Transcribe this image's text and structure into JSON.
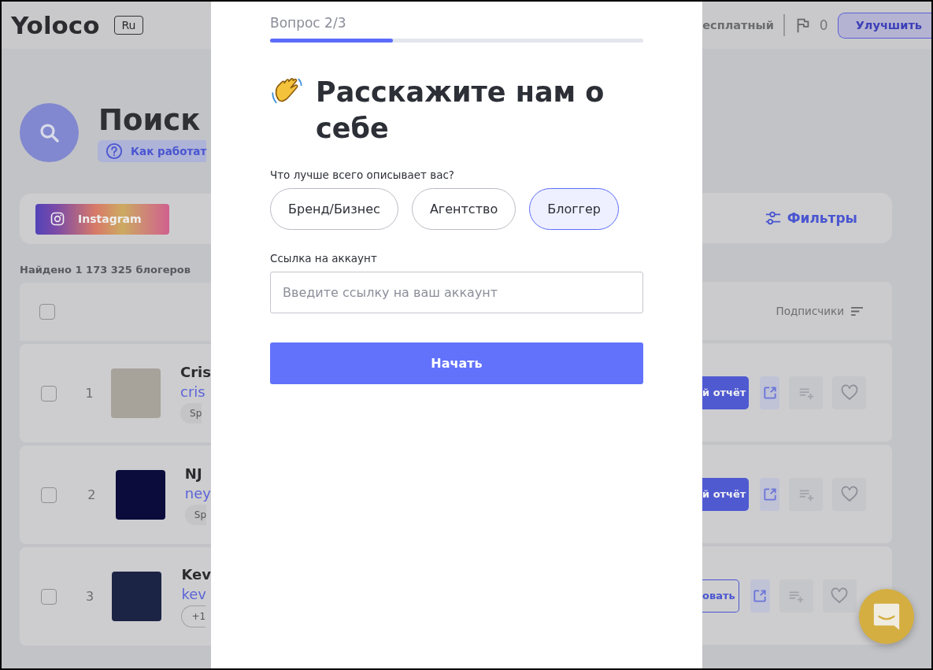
{
  "header": {
    "logo": "Yoloco",
    "language": "Ru",
    "plan": "есплатный",
    "flag_count": "0",
    "upgrade_button": "Улучшить"
  },
  "page": {
    "title": "Поиск",
    "help_link": "Как работат",
    "platform_tab": "Instagram",
    "filters_button": "Фильтры",
    "found": "Найдено 1 173 325 блогеров",
    "header_checked": false,
    "sort_column": "Подписчики"
  },
  "rows": [
    {
      "number": "1",
      "name": "Cris",
      "handle": "cris",
      "tag": {
        "text": "Sp",
        "kind": "chip"
      },
      "checked": false,
      "action": {
        "label": "й отчёт",
        "kind": "filled"
      }
    },
    {
      "number": "2",
      "name": "NJ",
      "handle": "ney",
      "tag": {
        "text": "Sp",
        "kind": "chip"
      },
      "checked": false,
      "action": {
        "label": "й отчёт",
        "kind": "filled"
      }
    },
    {
      "number": "3",
      "name": "Kev",
      "handle": "kev",
      "tag": {
        "text": "+1",
        "kind": "outline"
      },
      "checked": false,
      "action": {
        "label": "овать",
        "kind": "outline"
      }
    }
  ],
  "modal": {
    "progress_label": "Вопрос 2/3",
    "level": 0.33,
    "title": "Расскажите нам о себе",
    "question": "Что лучше всего описывает вас?",
    "options": [
      {
        "label": "Бренд/Бизнес",
        "selected": false
      },
      {
        "label": "Агентство",
        "selected": false
      },
      {
        "label": "Блоггер",
        "selected": true
      }
    ],
    "link_label": "Ссылка на аккаунт",
    "link_placeholder": "Введите ссылку на ваш аккаунт",
    "start_button": "Начать"
  }
}
